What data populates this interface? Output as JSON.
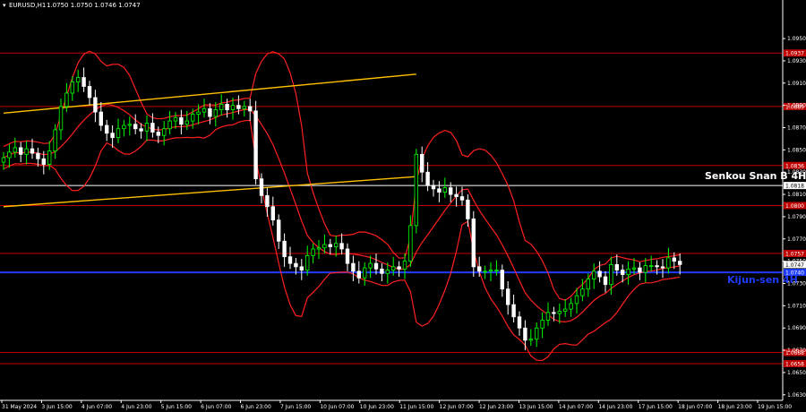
{
  "header": {
    "symbol": "EURUSD,H1",
    "ohlc": "1.0750 1.0750 1.0746 1.0747"
  },
  "colors": {
    "background": "#000000",
    "bull_candle": "#00ff00",
    "bear_candle": "#ffffff",
    "level_line": "#c00000",
    "bands": "#ff2020",
    "channel": "#ffc000",
    "senkou": "#ffffff",
    "kijun": "#1e3cff"
  },
  "chart_data": {
    "type": "candlestick",
    "ylim": [
      1.0625,
      1.0975
    ],
    "y_ticks": [
      "1.0950",
      "1.0930",
      "1.0910",
      "1.0890",
      "1.0870",
      "1.0850",
      "1.0830",
      "1.0810",
      "1.0790",
      "1.0770",
      "1.0750",
      "1.0730",
      "1.0710",
      "1.0690",
      "1.0670",
      "1.0650",
      "1.0630"
    ],
    "x_ticks": [
      "31 May 2024",
      "3 Jun 15:00",
      "4 Jun 07:00",
      "4 Jun 23:00",
      "5 Jun 15:00",
      "6 Jun 07:00",
      "6 Jun 23:00",
      "7 Jun 15:00",
      "10 Jun 07:00",
      "10 Jun 23:00",
      "11 Jun 15:00",
      "12 Jun 07:00",
      "12 Jun 23:00",
      "13 Jun 15:00",
      "14 Jun 07:00",
      "14 Jun 23:00",
      "17 Jun 15:00",
      "18 Jun 07:00",
      "18 Jun 23:00",
      "19 Jun 15:00"
    ],
    "levels": [
      {
        "price": 1.0937,
        "label": "1.0937",
        "color": "#c00000"
      },
      {
        "price": 1.0889,
        "label": "1.0889",
        "color": "#c00000"
      },
      {
        "price": 1.0836,
        "label": "1.0836",
        "color": "#c00000"
      },
      {
        "price": 1.0818,
        "label": "1.0818",
        "color": "#ffffff"
      },
      {
        "price": 1.08,
        "label": "1.0800",
        "color": "#c00000"
      },
      {
        "price": 1.0757,
        "label": "1.0757",
        "color": "#c00000"
      },
      {
        "price": 1.074,
        "label": "1.0740",
        "color": "#1e3cff"
      },
      {
        "price": 1.0668,
        "label": "1.0668",
        "color": "#c00000"
      },
      {
        "price": 1.0658,
        "label": "1.0658",
        "color": "#c00000"
      }
    ],
    "current_price": "1.0747",
    "senkou_label": "Senkou Snan B 4H",
    "kijun_label": "Kijun-sen 4H",
    "channel_upper": [
      [
        0,
        1.0883
      ],
      [
        72,
        1.0918
      ]
    ],
    "channel_lower": [
      [
        0,
        1.0799
      ],
      [
        72,
        1.0826
      ]
    ],
    "close": [
      1.0843,
      1.0848,
      1.0852,
      1.0846,
      1.0851,
      1.0847,
      1.0842,
      1.0837,
      1.0849,
      1.0868,
      1.0889,
      1.0901,
      1.0911,
      1.0915,
      1.0907,
      1.0897,
      1.0884,
      1.0872,
      1.0865,
      1.0861,
      1.0869,
      1.0872,
      1.0873,
      1.0869,
      1.0867,
      1.0874,
      1.0866,
      1.0863,
      1.0869,
      1.0876,
      1.0879,
      1.0873,
      1.0876,
      1.0882,
      1.0884,
      1.0887,
      1.088,
      1.0886,
      1.0891,
      1.0886,
      1.089,
      1.0887,
      1.0889,
      1.0885,
      1.0824,
      1.0809,
      1.0799,
      1.0787,
      1.0768,
      1.0754,
      1.0748,
      1.0745,
      1.0742,
      1.0755,
      1.0761,
      1.0762,
      1.0765,
      1.0763,
      1.0766,
      1.0761,
      1.0748,
      1.0741,
      1.0735,
      1.0744,
      1.0748,
      1.0743,
      1.0739,
      1.0742,
      1.0745,
      1.0743,
      1.075,
      1.0782,
      1.0846,
      1.083,
      1.0818,
      1.0815,
      1.0812,
      1.0816,
      1.081,
      1.0808,
      1.0805,
      1.0788,
      1.0745,
      1.0741,
      1.0741,
      1.0742,
      1.0742,
      1.0725,
      1.0711,
      1.07,
      1.069,
      1.0679,
      1.068,
      1.069,
      1.0697,
      1.0704,
      1.0703,
      1.0705,
      1.0707,
      1.0712,
      1.0719,
      1.0725,
      1.0734,
      1.0741,
      1.0736,
      1.0729,
      1.0747,
      1.0742,
      1.0738,
      1.0743,
      1.0744,
      1.074,
      1.0746,
      1.0746,
      1.0745,
      1.0744,
      1.0753,
      1.075,
      1.0747
    ]
  }
}
